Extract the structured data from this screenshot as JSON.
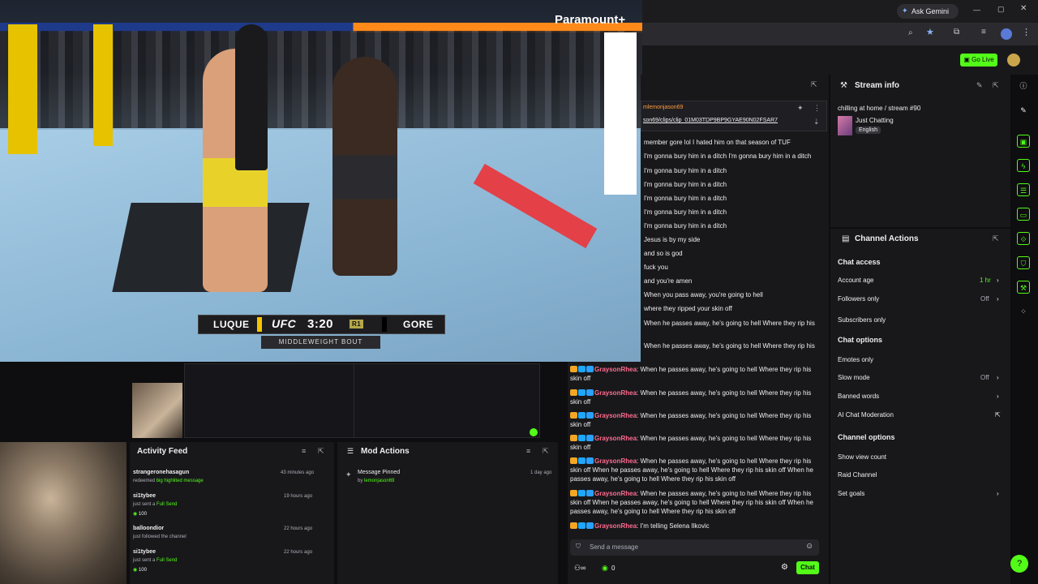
{
  "browser": {
    "ask_gemini": "Ask Gemini",
    "go_live": "Go Live"
  },
  "video": {
    "broadcaster_logo": "Paramount+",
    "fighter_left": "LUQUE",
    "fighter_right": "GORE",
    "brand": "UFC",
    "clock": "3:20",
    "round": "R1",
    "bout": "MIDDLEWEIGHT BOUT"
  },
  "chat": {
    "pinned_user": "mlemonjason69",
    "pinned_link": "son69/clips/clip_01M03TDP9BP9GYAE90N02FSAR7",
    "lines": [
      "member gore lol I hated him on that season of TUF",
      "I'm gonna bury him in a ditch I'm gonna bury him in a ditch",
      "I'm gonna bury him in a ditch",
      "I'm gonna bury him in a ditch",
      "I'm gonna bury him in a ditch",
      "I'm gonna bury him in a ditch",
      "I'm gonna bury him in a ditch",
      "Jesus is by my side",
      "and so is god",
      "fuck you",
      "and you're amen",
      "When you pass away, you're going to hell",
      "where they ripped your skin off",
      "When he passes away, he's going to hell Where they rip his",
      "When he passes away, he's going to hell Where they rip his"
    ],
    "messages": [
      {
        "user": "GraysonRhea",
        "text": ": When he passes away, he's going to hell Where they rip his skin off"
      },
      {
        "user": "GraysonRhea",
        "text": ": When he passes away, he's going to hell Where they rip his skin off"
      },
      {
        "user": "GraysonRhea",
        "text": ": When he passes away, he's going to hell Where they rip his skin off"
      },
      {
        "user": "GraysonRhea",
        "text": ": When he passes away, he's going to hell Where they rip his skin off"
      },
      {
        "user": "GraysonRhea",
        "text": ": When he passes away, he's going to hell Where they rip his skin off When he passes away, he's going to hell Where they rip his skin off When he passes away, he's going to hell Where they rip his skin off"
      },
      {
        "user": "GraysonRhea",
        "text": ": When he passes away, he's going to hell Where they rip his skin off When he passes away, he's going to hell Where they rip his skin off When he passes away, he's going to hell Where they rip his skin off"
      },
      {
        "user": "GraysonRhea",
        "text": ": I'm telling Selena Ilkovic"
      }
    ],
    "send_placeholder": "Send a message",
    "viewer_count": "0",
    "chat_button": "Chat"
  },
  "stream_info": {
    "title": "Stream info",
    "stream_title": "chilling at home / stream #90",
    "category": "Just Chatting",
    "language": "English"
  },
  "channel_actions": {
    "title": "Channel Actions",
    "chat_access": "Chat access",
    "account_age": "Account age",
    "account_age_val": "1 hr",
    "followers_only": "Followers only",
    "followers_only_val": "Off",
    "subscribers_only": "Subscribers only",
    "chat_options": "Chat options",
    "emotes_only": "Emotes only",
    "slow_mode": "Slow mode",
    "slow_mode_val": "Off",
    "banned_words": "Banned words",
    "ai_moderation": "AI Chat Moderation",
    "channel_options": "Channel options",
    "show_view_count": "Show view count",
    "raid_channel": "Raid Channel",
    "set_goals": "Set goals"
  },
  "activity_feed": {
    "title": "Activity Feed",
    "items": [
      {
        "name": "strangeronehasagun",
        "sub_pre": "redeemed ",
        "sub_hl": "big highlited message",
        "time": "43 minutes ago",
        "amount": ""
      },
      {
        "name": "si1tybee",
        "sub_pre": "just sent a ",
        "sub_hl": "Full Send",
        "time": "19 hours ago",
        "amount": "100"
      },
      {
        "name": "balloondior",
        "sub_pre": "just followed the channel",
        "sub_hl": "",
        "time": "22 hours ago",
        "amount": ""
      },
      {
        "name": "si1tybee",
        "sub_pre": "just sent a ",
        "sub_hl": "Full Send",
        "time": "22 hours ago",
        "amount": "100"
      }
    ]
  },
  "mod_actions": {
    "title": "Mod Actions",
    "item_title": "Message Pinned",
    "item_by_pre": "by ",
    "item_by_user": "lemonjason69",
    "item_time": "1 day ago"
  },
  "colors": {
    "accent": "#53fc18",
    "username": "#ff6b8f",
    "panel": "#18181b"
  }
}
